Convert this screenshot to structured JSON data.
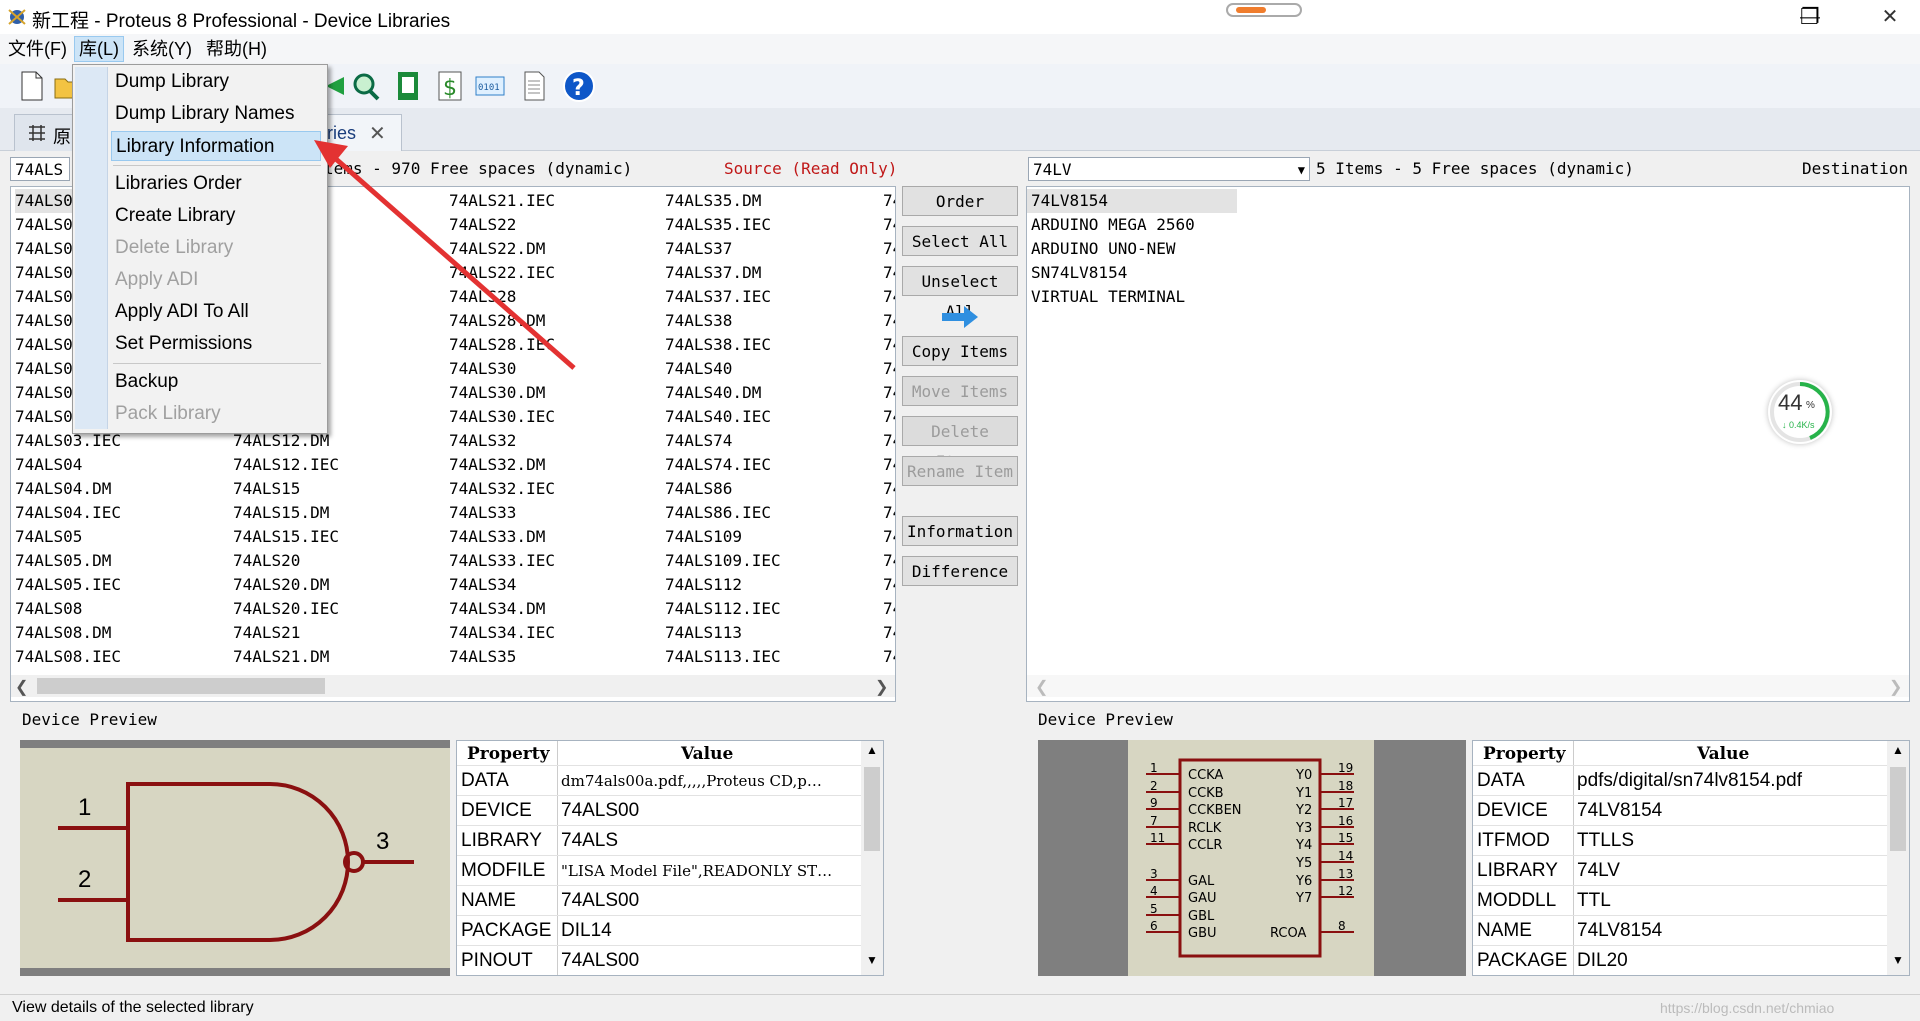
{
  "window": {
    "title": "新工程 - Proteus 8 Professional - Device Libraries",
    "minimize": "—",
    "restore": "❐",
    "close": "✕"
  },
  "menubar": [
    "文件(F)",
    "库(L)",
    "系统(Y)",
    "帮助(H)"
  ],
  "tab": {
    "label_left": "原",
    "label_right": "ries",
    "close": "✕"
  },
  "dropdown": {
    "group1": [
      "Dump Library",
      "Dump Library Names",
      "Library Information"
    ],
    "group2": [
      "Libraries Order",
      "Create Library",
      "Delete Library",
      "Apply ADI",
      "Apply ADI To All",
      "Set Permissions"
    ],
    "group3": [
      "Backup",
      "Pack Library"
    ]
  },
  "source": {
    "library": "74ALS",
    "status_partial": "tems - 970 Free spaces (dynamic)",
    "role": "Source (Read Only)",
    "columns": [
      [
        "74ALS0",
        "74ALS0",
        "74ALS0",
        "74ALS0",
        "74ALS0",
        "74ALS0",
        "74ALS0",
        "74ALS0",
        "74ALS0",
        "74ALS0",
        "74ALS03.IEC",
        "74ALS04",
        "74ALS04.DM",
        "74ALS04.IEC",
        "74ALS05",
        "74ALS05.DM",
        "74ALS05.IEC",
        "74ALS08",
        "74ALS08.DM",
        "74ALS08.IEC"
      ],
      [
        "",
        "M",
        "C",
        "",
        "",
        "C",
        "",
        "M",
        "C",
        "",
        "74ALS12.DM",
        "74ALS12.IEC",
        "74ALS15",
        "74ALS15.DM",
        "74ALS15.IEC",
        "74ALS20",
        "74ALS20.DM",
        "74ALS20.IEC",
        "74ALS21",
        "74ALS21.DM"
      ],
      [
        "74ALS21.IEC",
        "74ALS22",
        "74ALS22.DM",
        "74ALS22.IEC",
        "74ALS28",
        "74ALS28.DM",
        "74ALS28.IEC",
        "74ALS30",
        "74ALS30.DM",
        "74ALS30.IEC",
        "74ALS32",
        "74ALS32.DM",
        "74ALS32.IEC",
        "74ALS33",
        "74ALS33.DM",
        "74ALS33.IEC",
        "74ALS34",
        "74ALS34.DM",
        "74ALS34.IEC",
        "74ALS35"
      ],
      [
        "74ALS35.DM",
        "74ALS35.IEC",
        "74ALS37",
        "74ALS37.DM",
        "74ALS37.IEC",
        "74ALS38",
        "74ALS38.IEC",
        "74ALS40",
        "74ALS40.DM",
        "74ALS40.IEC",
        "74ALS74",
        "74ALS74.IEC",
        "74ALS86",
        "74ALS86.IEC",
        "74ALS109",
        "74ALS109.IEC",
        "74ALS112",
        "74ALS112.IEC",
        "74ALS113",
        "74ALS113.IEC"
      ],
      [
        "74",
        "74",
        "74",
        "74",
        "74",
        "74",
        "74",
        "74",
        "74",
        "74",
        "74",
        "74",
        "74",
        "74",
        "74",
        "74",
        "74",
        "74",
        "74",
        "74"
      ]
    ]
  },
  "destination": {
    "library": "74LV",
    "status": "5 Items - 5 Free spaces (dynamic)",
    "role": "Destination",
    "items": [
      "74LV8154",
      "ARDUINO MEGA 2560",
      "ARDUINO UNO-NEW",
      "SN74LV8154",
      "VIRTUAL TERMINAL"
    ]
  },
  "buttons": {
    "order": "Order",
    "select_all": "Select All",
    "unselect_all": "Unselect All",
    "copy": "Copy Items",
    "move": "Move Items",
    "delete": "Delete Items",
    "rename": "Rename Item",
    "information": "Information",
    "difference": "Difference"
  },
  "left_preview": {
    "label": "Device Preview",
    "pins": [
      "1",
      "2",
      "3"
    ],
    "props_header": [
      "Property",
      "Value"
    ],
    "props": [
      [
        "DATA",
        "dm74als00a.pdf,,,,,Proteus CD,p…"
      ],
      [
        "DEVICE",
        "74ALS00"
      ],
      [
        "LIBRARY",
        "74ALS"
      ],
      [
        "MODFILE",
        "\"LISA Model File\",READONLY ST…"
      ],
      [
        "NAME",
        "74ALS00"
      ],
      [
        "PACKAGE",
        "DIL14"
      ],
      [
        "PINOUT",
        "74ALS00"
      ]
    ]
  },
  "right_preview": {
    "label": "Device Preview",
    "chip": {
      "left_pins": [
        [
          "1",
          "CCKA"
        ],
        [
          "2",
          "CCKB"
        ],
        [
          "9",
          "CCKBEN"
        ],
        [
          "7",
          "RCLK"
        ],
        [
          "11",
          "CCLR"
        ],
        [
          "3",
          "GAL"
        ],
        [
          "4",
          "GAU"
        ],
        [
          "5",
          "GBL"
        ],
        [
          "6",
          "GBU"
        ]
      ],
      "right_pins": [
        [
          "19",
          "Y0"
        ],
        [
          "18",
          "Y1"
        ],
        [
          "17",
          "Y2"
        ],
        [
          "16",
          "Y3"
        ],
        [
          "15",
          "Y4"
        ],
        [
          "14",
          "Y5"
        ],
        [
          "13",
          "Y6"
        ],
        [
          "12",
          "Y7"
        ],
        [
          "8",
          "RCOA"
        ]
      ]
    },
    "props_header": [
      "Property",
      "Value"
    ],
    "props": [
      [
        "DATA",
        "pdfs/digital/sn74lv8154.pdf"
      ],
      [
        "DEVICE",
        "74LV8154"
      ],
      [
        "ITFMOD",
        "TTLLS"
      ],
      [
        "LIBRARY",
        "74LV"
      ],
      [
        "MODDLL",
        "TTL"
      ],
      [
        "NAME",
        "74LV8154"
      ],
      [
        "PACKAGE",
        "DIL20"
      ]
    ]
  },
  "net_widget": {
    "percent": "44",
    "unit": "%",
    "speed": "↓ 0.4K/s"
  },
  "status_bar": "View details of the selected library",
  "watermark": "https://blog.csdn.net/chmiao"
}
